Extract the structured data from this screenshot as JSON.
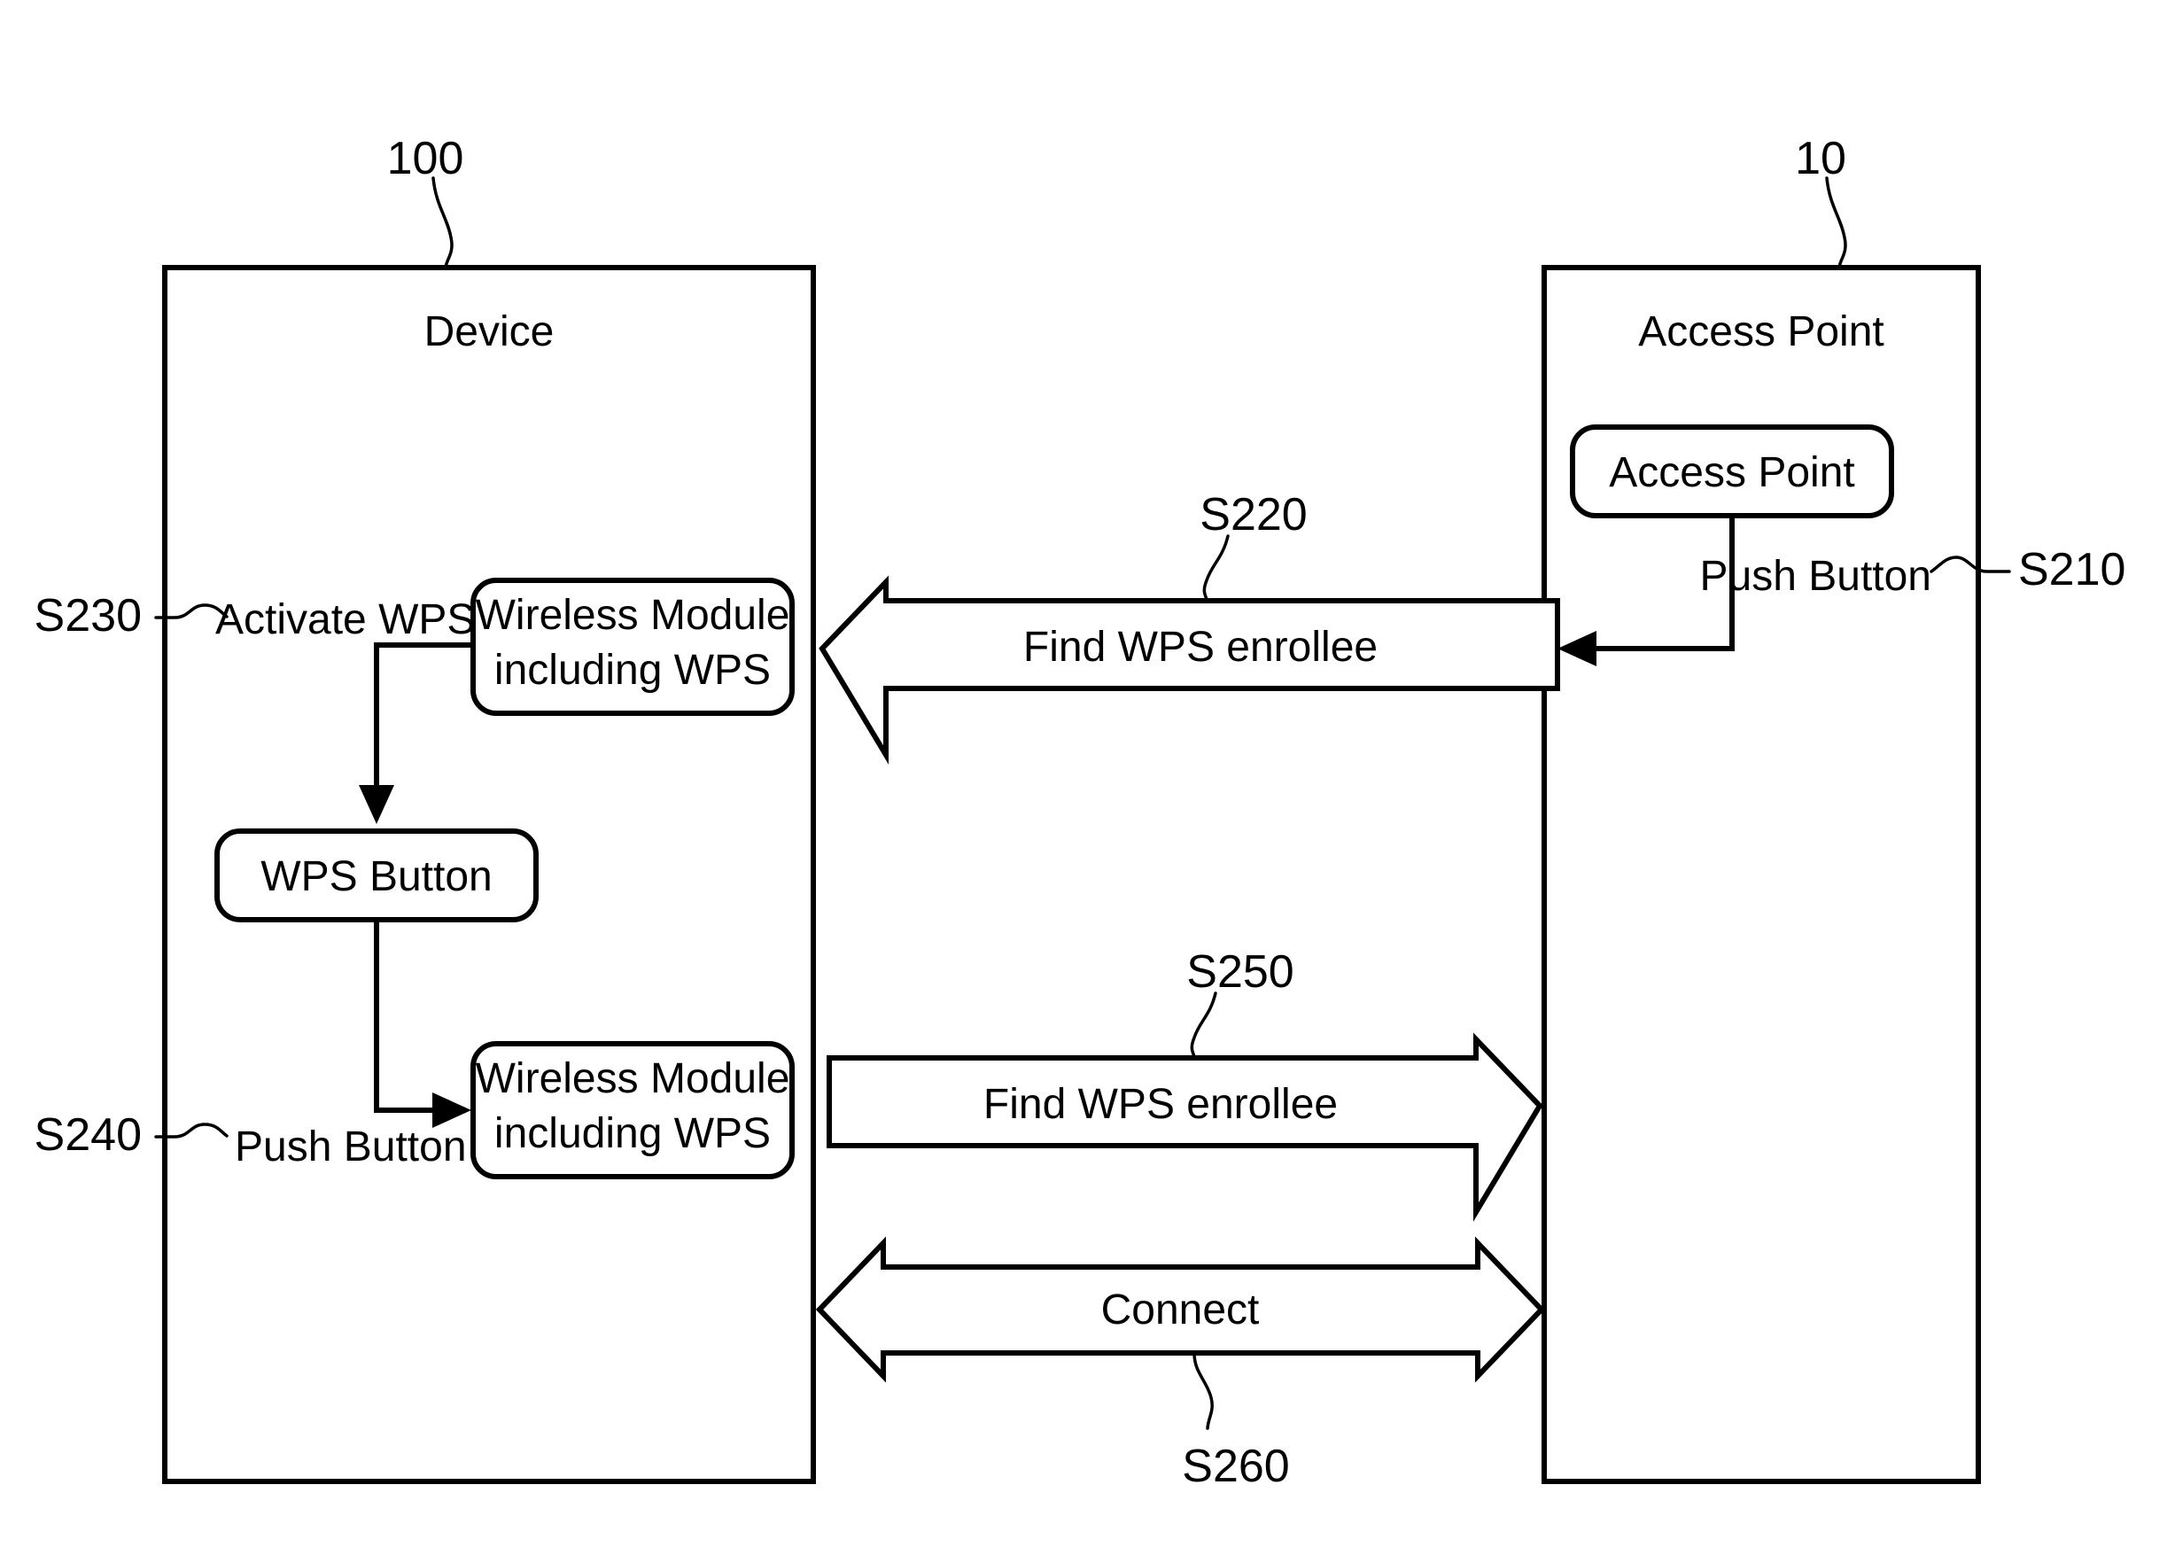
{
  "figure": {
    "type": "patent-flow-diagram",
    "background_color": "#ffffff",
    "line_color": "#000000"
  },
  "reference_numerals": {
    "device": "100",
    "access_point": "10",
    "step_ap_push_button": "S210",
    "step_find_wps_enrollee_down": "S220",
    "step_activate_wps": "S230",
    "step_push_button": "S240",
    "step_find_wps_enrollee_up": "S250",
    "step_connect": "S260"
  },
  "device_panel": {
    "title": "Device",
    "nodes": [
      {
        "id": "wireless-module-top",
        "line1": "Wireless Module",
        "line2": "including WPS"
      },
      {
        "id": "wps-button",
        "line1": "WPS Button"
      },
      {
        "id": "wireless-module-bottom",
        "line1": "Wireless Module",
        "line2": "including WPS"
      }
    ],
    "labels": {
      "activate_wps": "Activate WPS",
      "push_button": "Push Button"
    }
  },
  "ap_panel": {
    "title": "Access Point",
    "nodes": [
      {
        "id": "access-point-node",
        "line1": "Access Point"
      }
    ],
    "labels": {
      "push_button": "Push Button"
    }
  },
  "messages": [
    {
      "id": "s220",
      "label": "Find WPS enrollee",
      "ref": "S220",
      "direction": "right-to-left"
    },
    {
      "id": "s250",
      "label": "Find WPS enrollee",
      "ref": "S250",
      "direction": "left-to-right"
    },
    {
      "id": "s260",
      "label": "Connect",
      "ref": "S260",
      "direction": "bidirectional"
    }
  ]
}
